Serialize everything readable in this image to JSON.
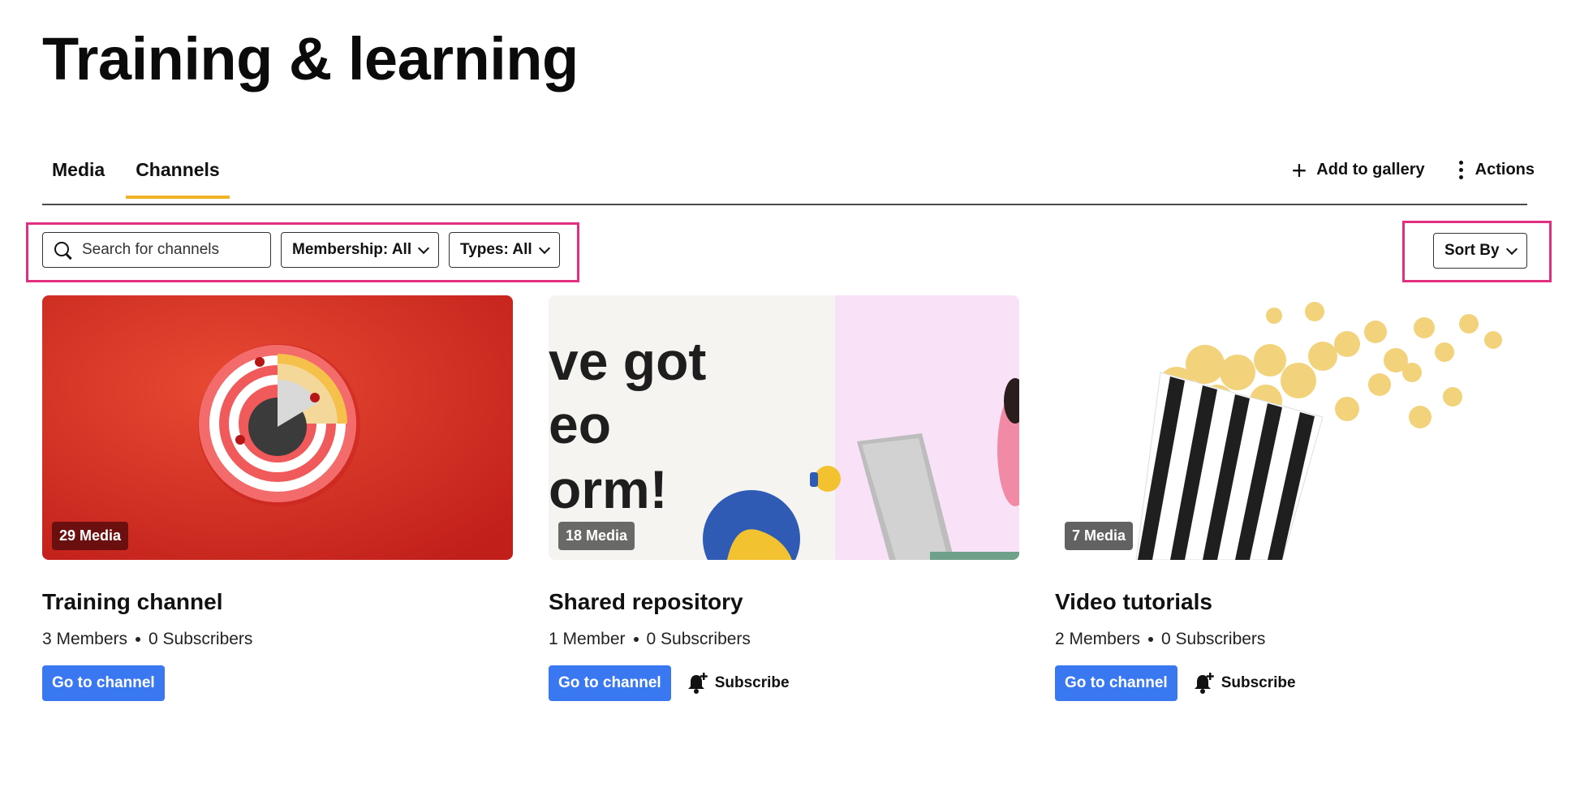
{
  "page": {
    "title": "Training & learning"
  },
  "tabs": [
    {
      "label": "Media",
      "active": false
    },
    {
      "label": "Channels",
      "active": true
    }
  ],
  "header_actions": {
    "add_label": "Add to gallery",
    "actions_label": "Actions"
  },
  "filters": {
    "search_placeholder": "Search for channels",
    "membership_label": "Membership: All",
    "types_label": "Types: All",
    "sort_label": "Sort By"
  },
  "colors": {
    "accent_tab": "#f0b323",
    "primary_button": "#3a78f2",
    "highlight": "#e0307f"
  },
  "channels": [
    {
      "media_count": "29 Media",
      "title": "Training channel",
      "members": "3 Members",
      "subscribers": "0 Subscribers",
      "go_label": "Go to channel",
      "subscribe_label": "",
      "thumb_icon": "dartboard-image"
    },
    {
      "media_count": "18 Media",
      "title": "Shared repository",
      "members": "1 Member",
      "subscribers": "0 Subscribers",
      "go_label": "Go to channel",
      "subscribe_label": "Subscribe",
      "thumb_icon": "promo-image",
      "thumb_text": [
        "ve got",
        "eo",
        "orm!"
      ]
    },
    {
      "media_count": "7 Media",
      "title": "Video tutorials",
      "members": "2 Members",
      "subscribers": "0 Subscribers",
      "go_label": "Go to channel",
      "subscribe_label": "Subscribe",
      "thumb_icon": "popcorn-image"
    }
  ]
}
